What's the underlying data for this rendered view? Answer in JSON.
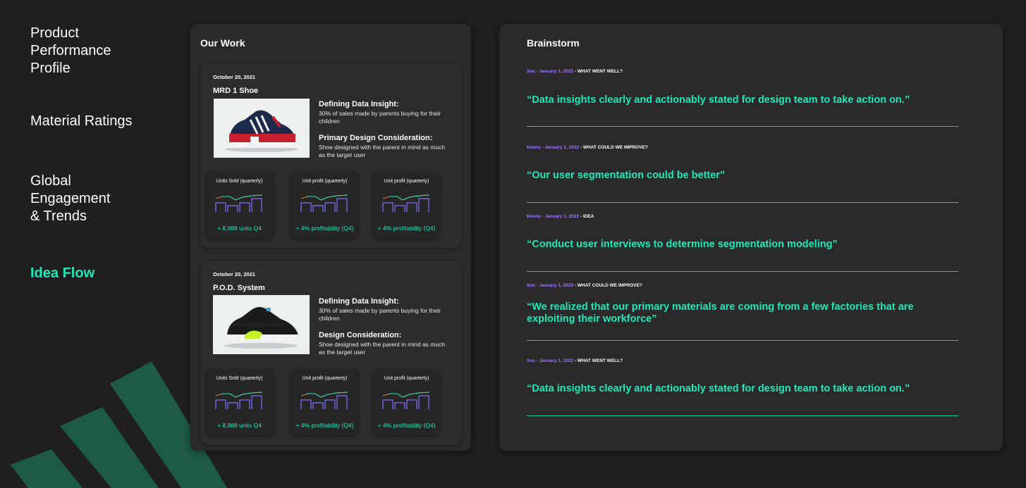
{
  "nav": {
    "items": [
      {
        "label": "Product\nPerformance\nProfile",
        "active": false
      },
      {
        "label": "Material Ratings",
        "active": false
      },
      {
        "label": "Global\nEngagement\n& Trends",
        "active": false
      },
      {
        "label": "Idea Flow",
        "active": true
      }
    ]
  },
  "colors": {
    "accent": "#1de9b6",
    "author": "#9b7cff",
    "chart_bars": "#7c6cf0",
    "chart_line_up": "#1de9b6",
    "chart_line_down": "#e07a4a"
  },
  "work": {
    "title": "Our Work",
    "products": [
      {
        "date": "October 20, 2021",
        "name": "MRD 1 Shoe",
        "insight_heading": "Defining Data Insight:",
        "insight_text": "30% of sales made by parents buying for their children",
        "consideration_heading": "Primary Design Consideration:",
        "consideration_text": "Shoe designed with the parent in mind as much as the target user",
        "metrics": [
          {
            "title": "Units Sold (quarterly)",
            "stat": "+ 8,888 units Q4"
          },
          {
            "title": "Unit profit (quarterly)",
            "stat": "+ 4% profitability (Q4)"
          },
          {
            "title": "Unit profit (quarterly)",
            "stat": "+ 4% profitability (Q4)"
          }
        ]
      },
      {
        "date": "October 20, 2021",
        "name": "P.O.D. System",
        "insight_heading": "Defining Data Insight:",
        "insight_text": "30% of sales made by parents buying for their children",
        "consideration_heading": "Design Consideration:",
        "consideration_text": "Shoe designed with the parent in mind as much as the target user",
        "metrics": [
          {
            "title": "Units Sold (quarterly)",
            "stat": "+ 8,888 units Q4"
          },
          {
            "title": "Unit profit (quarterly)",
            "stat": "+ 4% profitability (Q4)"
          },
          {
            "title": "Unit profit (quarterly)",
            "stat": "+ 4% profitability (Q4)"
          }
        ]
      }
    ]
  },
  "brainstorm": {
    "title": "Brainstorm",
    "entries": [
      {
        "author": "Sos - January 1, 2022",
        "category": "WHAT WENT WELL?",
        "quote": "“Data insights clearly and actionably stated for design team to take action on.”"
      },
      {
        "author": "Kenny - January 1, 2022",
        "category": "WHAT COULD WE IMPROVE?",
        "quote": "“Our user segmentation could be better”"
      },
      {
        "author": "Kenny - January 1, 2022",
        "category": "IDEA",
        "quote": "“Conduct user interviews to determine segmentation modeling”"
      },
      {
        "author": "Sos - January 1, 2022",
        "category": "WHAT COULD WE IMPROVE?",
        "quote": "“We realized that our primary materials are coming from a few factories that are exploiting their workforce”"
      },
      {
        "author": "Sos - January 1, 2022",
        "category": "WHAT WENT WELL?",
        "quote": "“Data insights clearly and actionably stated for design team to take action on.”"
      }
    ]
  }
}
